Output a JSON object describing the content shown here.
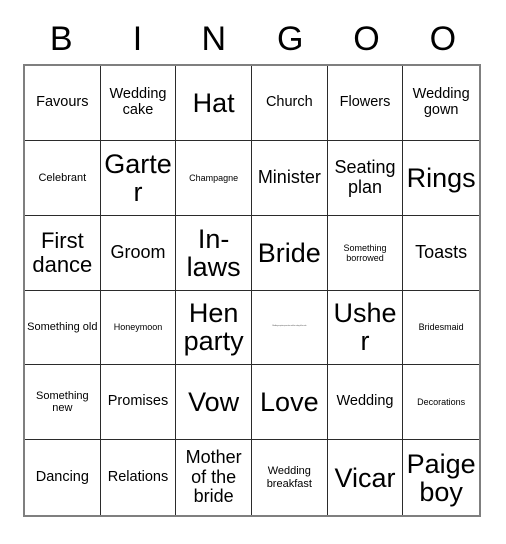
{
  "card": {
    "header_letters": [
      "B",
      "I",
      "N",
      "G",
      "O",
      "O"
    ],
    "columns": 6,
    "rows": 6,
    "border_color": "#2b2b2b",
    "frame_color": "#7f7f7f",
    "background_color": "#ffffff",
    "text_color": "#000000",
    "cells": [
      [
        {
          "text": "Favours",
          "size": "md"
        },
        {
          "text": "Wedding cake",
          "size": "md"
        },
        {
          "text": "Hat",
          "size": "xxl"
        },
        {
          "text": "Church",
          "size": "md"
        },
        {
          "text": "Flowers",
          "size": "md"
        },
        {
          "text": "Wedding gown",
          "size": "md"
        }
      ],
      [
        {
          "text": "Celebrant",
          "size": "sm"
        },
        {
          "text": "Garter",
          "size": "xxl"
        },
        {
          "text": "Champagne",
          "size": "xs"
        },
        {
          "text": "Minister",
          "size": "lg"
        },
        {
          "text": "Seating plan",
          "size": "lg"
        },
        {
          "text": "Rings",
          "size": "xxl"
        }
      ],
      [
        {
          "text": "First dance",
          "size": "xl"
        },
        {
          "text": "Groom",
          "size": "lg"
        },
        {
          "text": "In-laws",
          "size": "xxl"
        },
        {
          "text": "Bride",
          "size": "xxl"
        },
        {
          "text": "Something borrowed",
          "size": "xs"
        },
        {
          "text": "Toasts",
          "size": "lg"
        }
      ],
      [
        {
          "text": "Something old",
          "size": "sm"
        },
        {
          "text": "Honeymoon",
          "size": "xs"
        },
        {
          "text": "Hen party",
          "size": "xxl"
        },
        {
          "text": "Wedding reception speeches and the cutting of the cake",
          "size": "xxs"
        },
        {
          "text": "Usher",
          "size": "xxl"
        },
        {
          "text": "Bridesmaid",
          "size": "xs"
        }
      ],
      [
        {
          "text": "Something new",
          "size": "sm"
        },
        {
          "text": "Promises",
          "size": "md"
        },
        {
          "text": "Vow",
          "size": "xxl"
        },
        {
          "text": "Love",
          "size": "xxl"
        },
        {
          "text": "Wedding",
          "size": "md"
        },
        {
          "text": "Decorations",
          "size": "xs"
        }
      ],
      [
        {
          "text": "Dancing",
          "size": "md"
        },
        {
          "text": "Relations",
          "size": "md"
        },
        {
          "text": "Mother of the bride",
          "size": "lg"
        },
        {
          "text": "Wedding breakfast",
          "size": "sm"
        },
        {
          "text": "Vicar",
          "size": "xxl"
        },
        {
          "text": "Paige boy",
          "size": "xxl"
        }
      ]
    ]
  }
}
